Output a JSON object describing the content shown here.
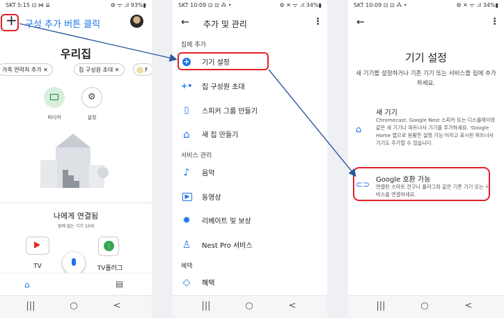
{
  "p1": {
    "status_left": "SKT 5:15 ⊡ ⋈ ⇊",
    "status_right": "⚙ ᯤ .ıl 93%▮",
    "plus": "+",
    "header_title": "구성 추가 버튼 클릭",
    "home_name": "우리집",
    "chips": [
      "가족 연락처 추가 ✕",
      "집 구성원 초대 ✕",
      "F"
    ],
    "media_label": "미디어",
    "settings_label": "설정",
    "connected_title": "나에게 연결됨",
    "connected_sub": "집에 없는 기기 10대",
    "tv_label": "TV",
    "plug_label": "TV플러그",
    "colors": {
      "accent": "#1a73e8",
      "annotation": "#e0202a"
    }
  },
  "p2": {
    "status_left": "SKT 10:09 ⊡ ⊡ ⁂ •",
    "status_right": "⚙ ✕ ᯤ .ıl 34%▮",
    "title": "추가 및 관리",
    "sec_add": "집에 추가",
    "items_add": [
      {
        "icon": "plus-circle-icon",
        "glyph": "+",
        "label": "기기 설정"
      },
      {
        "icon": "person-add-icon",
        "glyph": "+•",
        "label": "집 구성원 초대"
      },
      {
        "icon": "speaker-group-icon",
        "glyph": "▯",
        "label": "스피커 그룹 만들기"
      },
      {
        "icon": "home-icon",
        "glyph": "⌂",
        "label": "새 집 만들기"
      }
    ],
    "sec_service": "서비스 관리",
    "items_service": [
      {
        "icon": "music-icon",
        "glyph": "♪",
        "label": "음악"
      },
      {
        "icon": "video-icon",
        "glyph": "▶",
        "label": "동영상"
      },
      {
        "icon": "reward-icon",
        "glyph": "✹",
        "label": "리베이트 및 보상"
      },
      {
        "icon": "nest-pro-icon",
        "glyph": "♙",
        "label": "Nest Pro 서비스"
      }
    ],
    "sec_benefit": "혜택",
    "items_benefit": [
      {
        "icon": "tag-icon",
        "glyph": "◇",
        "label": "혜택"
      }
    ]
  },
  "p3": {
    "status_left": "SKT 10:09 ⊡ ⊡ ⁂ •",
    "status_right": "⚙ ✕ ᯤ .ıl 34%▮",
    "title": "기기 설정",
    "desc": "새 기기를 설정하거나 기존 기기 또는 서비스를 집에 추가하세요.",
    "opt1_title": "새 기기",
    "opt1_desc": "Chromecast, Google Nest 스피커 또는 디스플레이와 같은 새 기기나 파트너사 기기를 추가하세요. 'Google Home 앱으로 원활한 설정 가능'이라고 표시된 파트너사 기기도 추가할 수 있습니다.",
    "opt2_title": "Google 호환 가능",
    "opt2_desc": "연결된 스마트 전구나 플러그와 같은 기존 기기 또는 서비스를 연결하세요."
  },
  "nav": {
    "recents": "|||",
    "home": "○",
    "back": "<"
  }
}
